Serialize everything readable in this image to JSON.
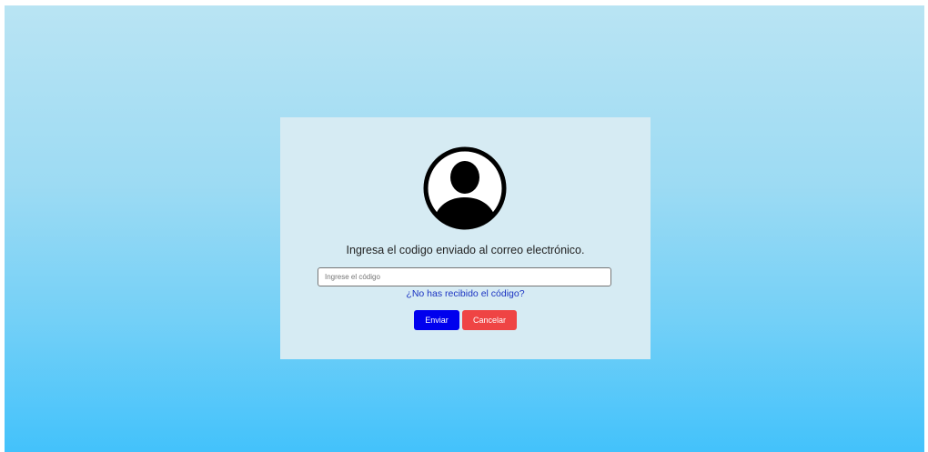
{
  "colors": {
    "background_top": "#b9e4f3",
    "background_bottom": "#43c2fb",
    "card": "#d6ebf3",
    "send_button": "#0000ee",
    "cancel_button": "#ef4444",
    "link": "#1a33c2"
  },
  "card": {
    "avatar_icon": "user-avatar-icon",
    "instruction": "Ingresa el codigo enviado al correo electrónico.",
    "code_input": {
      "value": "",
      "placeholder": "Ingrese el código"
    },
    "resend_link": "¿No has recibido el código?",
    "send_button": "Enviar",
    "cancel_button": "Cancelar"
  }
}
